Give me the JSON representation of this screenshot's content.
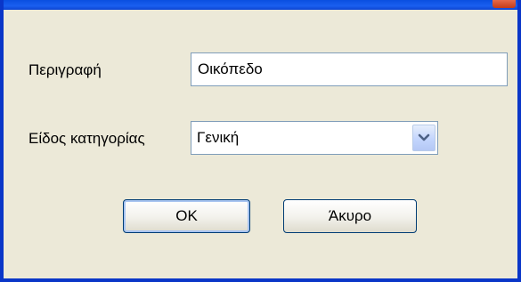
{
  "form": {
    "description_label": "Περιγραφή",
    "description_value": "Οικόπεδο",
    "category_label": "Είδος κατηγορίας",
    "category_value": "Γενική"
  },
  "buttons": {
    "ok_label": "OK",
    "cancel_label": "Άκυρο"
  },
  "colors": {
    "window_background": "#ece9d8",
    "window_border": "#0a36c8",
    "input_border": "#7f9db9"
  },
  "icons": {
    "dropdown": "chevron-down-icon"
  }
}
